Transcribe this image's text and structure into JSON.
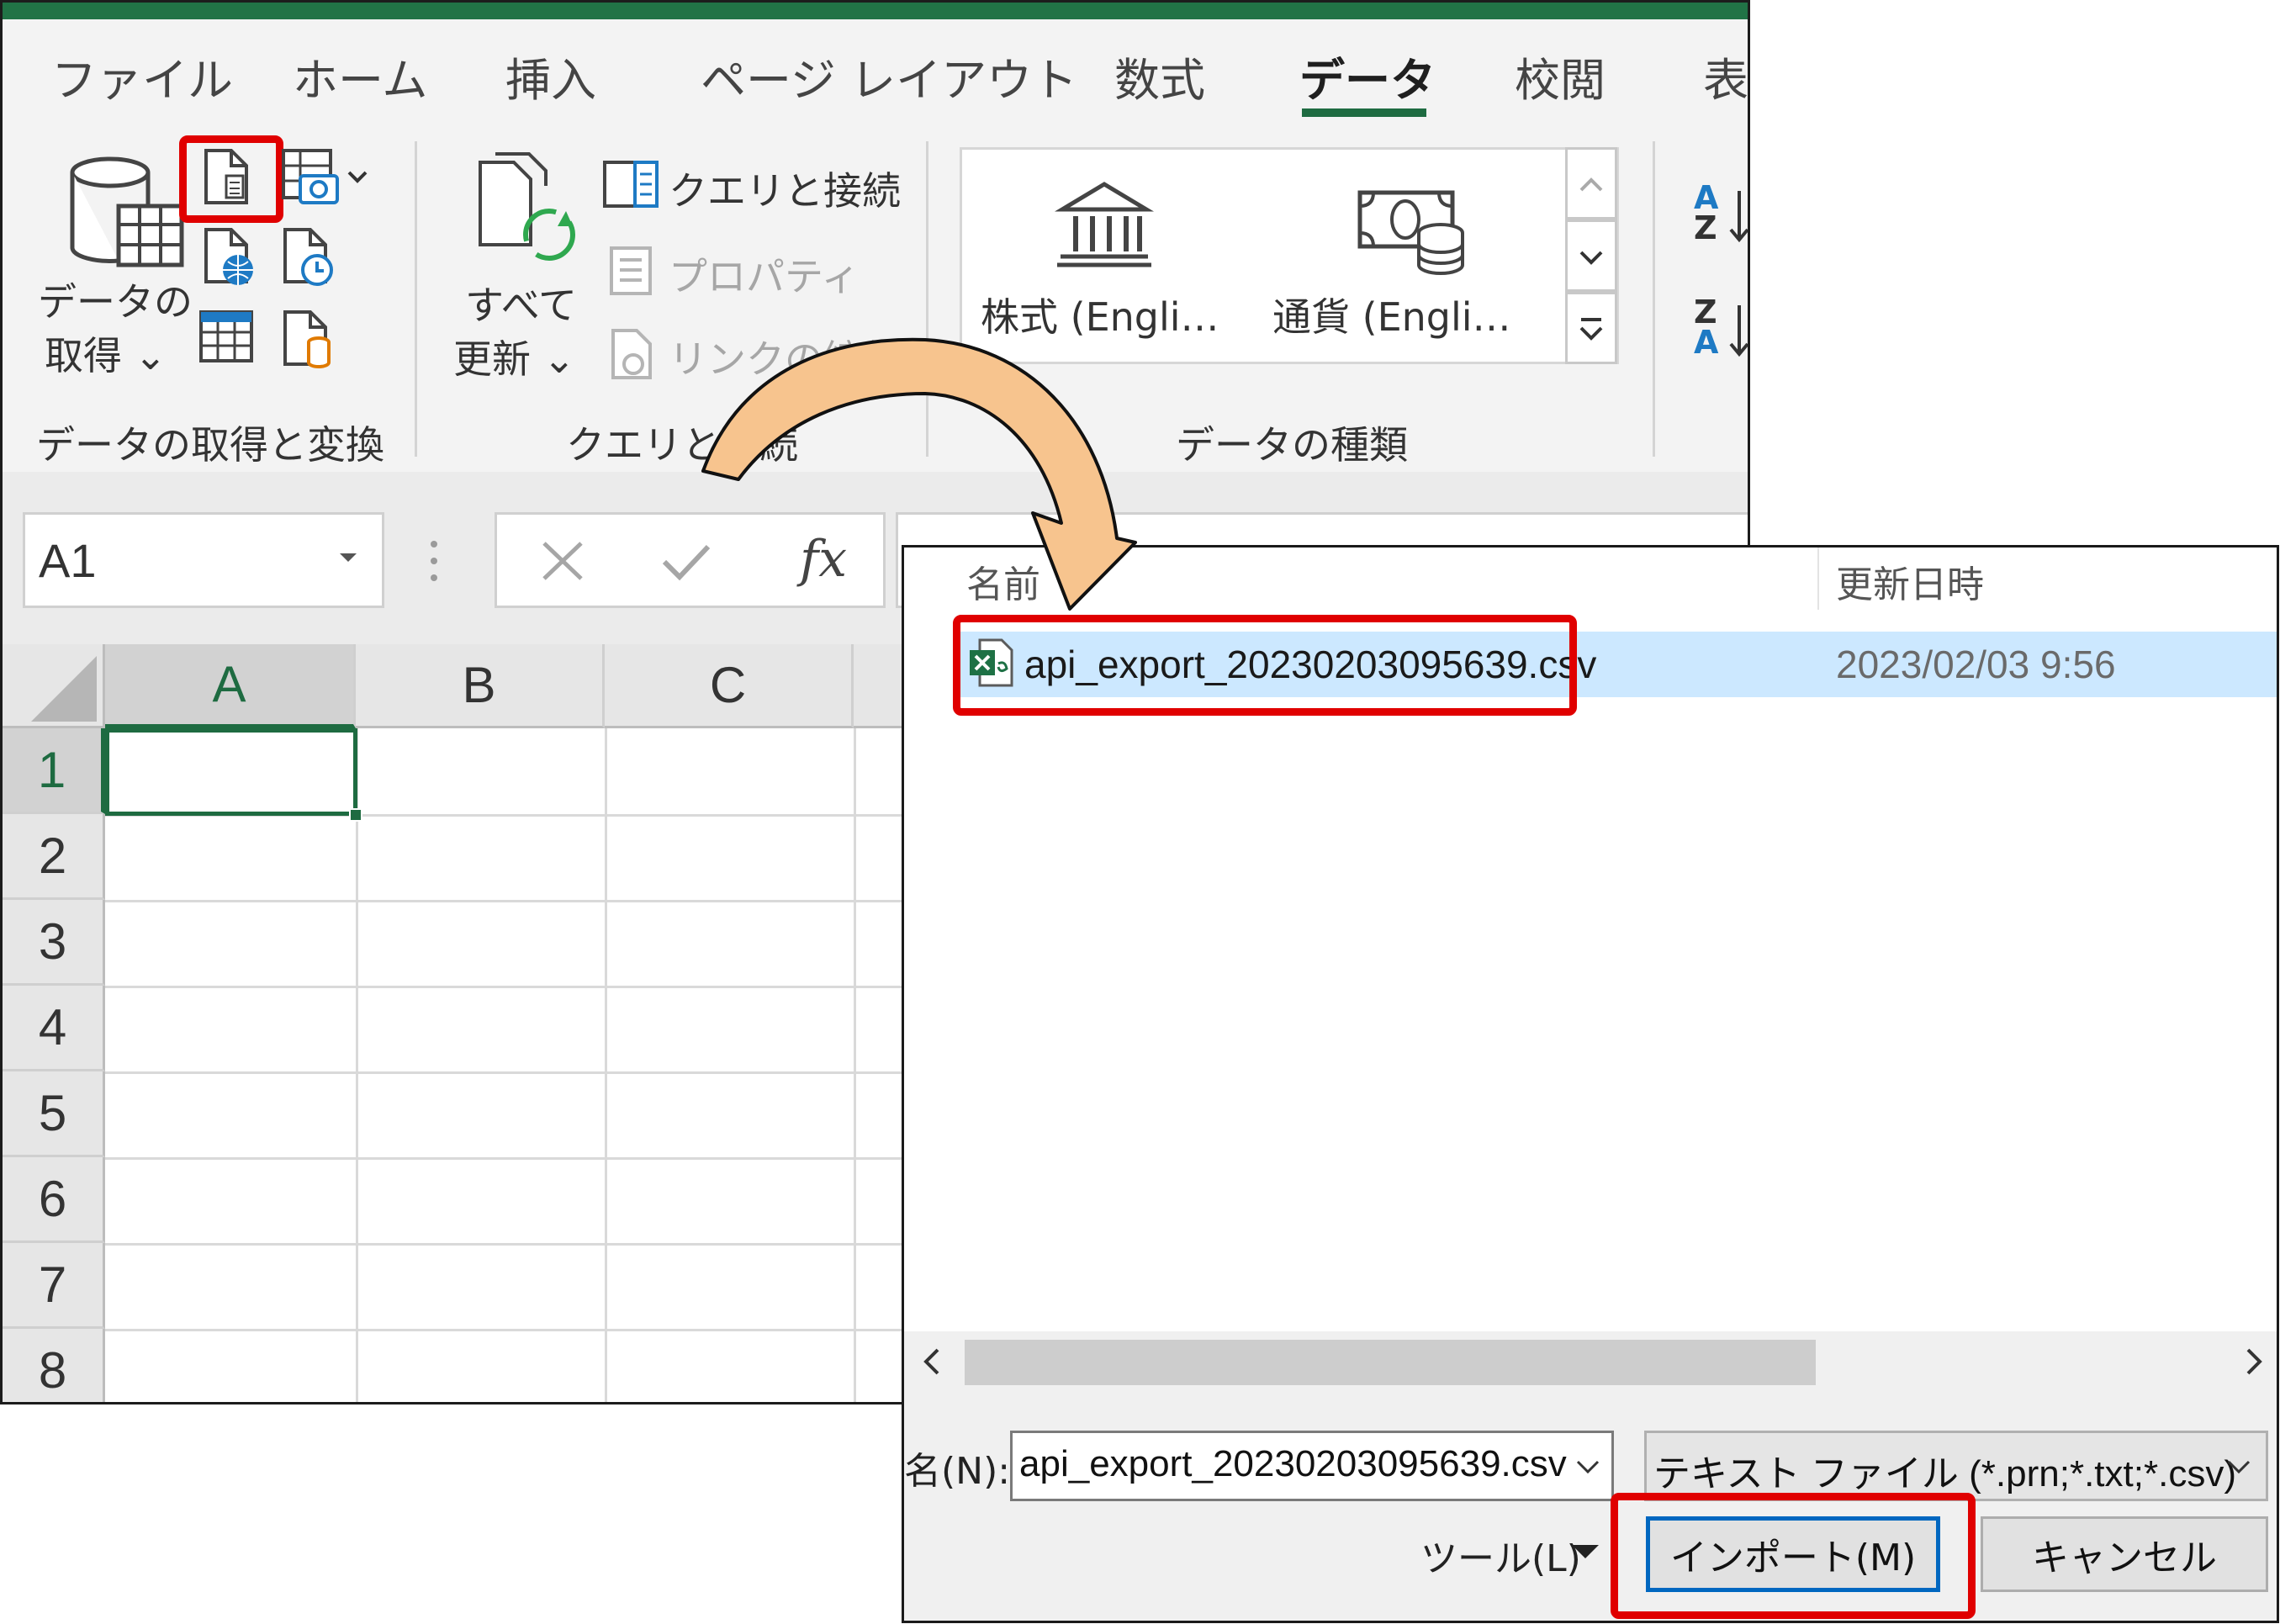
{
  "excel": {
    "tabs": [
      "ファイル",
      "ホーム",
      "挿入",
      "ページ レイアウト",
      "数式",
      "データ",
      "校閲",
      "表"
    ],
    "active_tab": "データ",
    "ribbon": {
      "get_data_line1": "データの",
      "get_data_line2": "取得 ⌄",
      "refresh_all_line1": "すべて",
      "refresh_all_line2": "更新 ⌄",
      "queries_connections": "クエリと接続",
      "properties": "プロパティ",
      "edit_links": "リンクの編集",
      "stocks": "株式 (Engli…",
      "currencies": "通貨 (Engli…",
      "group_get_transform": "データの取得と変換",
      "group_queries": "クエリと接続",
      "group_data_types": "データの種類",
      "sort_az_top": "A",
      "sort_az_bottom": "Z",
      "sort_za_top": "Z",
      "sort_za_bottom": "A"
    },
    "name_box": "A1",
    "fx": "fx",
    "columns": [
      "A",
      "B",
      "C"
    ],
    "rows": [
      "1",
      "2",
      "3",
      "4",
      "5",
      "6",
      "7",
      "8"
    ]
  },
  "dialog": {
    "col_name": "名前",
    "col_modified": "更新日時",
    "file": {
      "name": "api_export_20230203095639.csv",
      "modified": "2023/02/03 9:56"
    },
    "filename_label": "名(N):",
    "filename_value": "api_export_20230203095639.csv",
    "filetype_value": "テキスト ファイル (*.prn;*.txt;*.csv)",
    "tools_label": "ツール(L)",
    "import_button": "インポート(M)",
    "cancel_button": "キャンセル"
  },
  "colors": {
    "excel_green": "#217346",
    "highlight_red": "#e00000",
    "selection_blue": "#cce8ff",
    "arrow_fill": "#f7c48e"
  }
}
